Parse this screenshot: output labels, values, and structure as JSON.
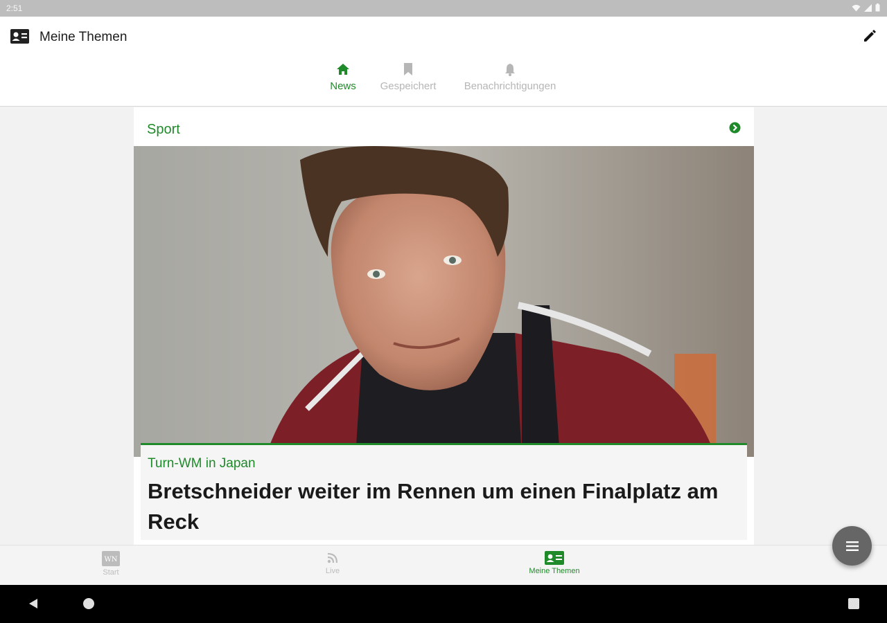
{
  "status_bar": {
    "time": "2:51"
  },
  "app_bar": {
    "title": "Meine Themen"
  },
  "tabs": [
    {
      "label": "News",
      "icon": "home-icon",
      "active": true
    },
    {
      "label": "Gespeichert",
      "icon": "bookmark-icon",
      "active": false
    },
    {
      "label": "Benachrichtigungen",
      "icon": "bell-icon",
      "active": false
    }
  ],
  "section": {
    "title": "Sport"
  },
  "article": {
    "kicker": "Turn-WM in Japan",
    "headline": "Bretschneider weiter im Rennen um einen Finalplatz am Reck"
  },
  "bottom_nav": [
    {
      "label": "Start",
      "icon": "wn-logo-icon",
      "active": false
    },
    {
      "label": "Live",
      "icon": "rss-icon",
      "active": false
    },
    {
      "label": "Meine Themen",
      "icon": "contact-card-icon",
      "active": true
    }
  ],
  "theme": {
    "accent": "#1f8a2a",
    "inactive": "#b6b6b6"
  }
}
